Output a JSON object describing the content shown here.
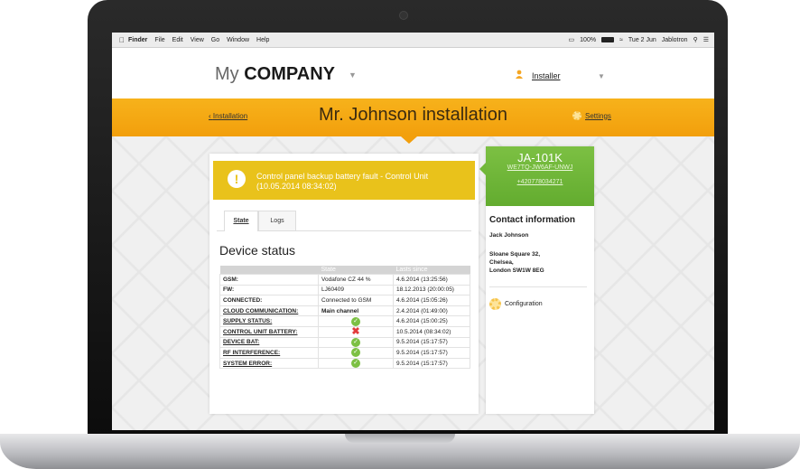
{
  "menubar": {
    "app": "Finder",
    "items": [
      "File",
      "Edit",
      "View",
      "Go",
      "Window",
      "Help"
    ],
    "battery": "100%",
    "datetime": "Tue 2 Jun",
    "user": "Jablotron"
  },
  "header": {
    "logo_prefix": "My",
    "logo_bold": "COMPANY",
    "user_label": "Installer"
  },
  "banner": {
    "back_link": "Installation",
    "title": "Mr. Johnson installation",
    "settings_label": "Settings"
  },
  "alert": {
    "text": "Control panel backup battery fault - Control Unit (10.05.2014 08:34:02)"
  },
  "tabs": [
    {
      "label": "State"
    },
    {
      "label": "Logs"
    }
  ],
  "device_status": {
    "title": "Device status",
    "columns": [
      "",
      "State",
      "Lasts since"
    ],
    "rows": [
      {
        "label": "GSM:",
        "state": "Vodafone CZ 44 %",
        "since": "4.6.2014 (13:25:56)"
      },
      {
        "label": "FW:",
        "state": "LJ60409",
        "since": "18.12.2013 (20:00:05)"
      },
      {
        "label": "CONNECTED:",
        "state": "Connected to GSM",
        "since": "4.6.2014 (15:05:26)"
      },
      {
        "label": "CLOUD COMMUNICATION:",
        "state": "Main channel",
        "since": "2.4.2014 (01:49:00)"
      },
      {
        "label": "SUPPLY STATUS:",
        "state": "",
        "icon": "ok",
        "since": "4.6.2014 (15:00:25)"
      },
      {
        "label": "CONTROL UNIT BATTERY:",
        "state": "",
        "icon": "fail",
        "since": "10.5.2014 (08:34:02)"
      },
      {
        "label": "DEVICE BAT:",
        "state": "",
        "icon": "ok",
        "since": "9.5.2014 (15:17:57)"
      },
      {
        "label": "RF INTERFERENCE:",
        "state": "",
        "icon": "ok",
        "since": "9.5.2014 (15:17:57)"
      },
      {
        "label": "SYSTEM ERROR:",
        "state": "",
        "icon": "ok",
        "since": "9.5.2014 (15:17:57)"
      }
    ]
  },
  "device": {
    "name": "JA-101K",
    "code": "WE7TQ-JW6AF-UNWJ",
    "phone": "+420778034271"
  },
  "contact": {
    "title": "Contact information",
    "name": "Jack Johnson",
    "address": [
      "Sloane Square 32,",
      "Chelsea,",
      "London SW1W 8EG"
    ]
  },
  "configuration_label": "Configuration",
  "colors": {
    "accent_orange": "#f29f0c",
    "alert_yellow": "#e9c21b",
    "device_green": "#7cc043",
    "fail_red": "#e23b3b"
  }
}
